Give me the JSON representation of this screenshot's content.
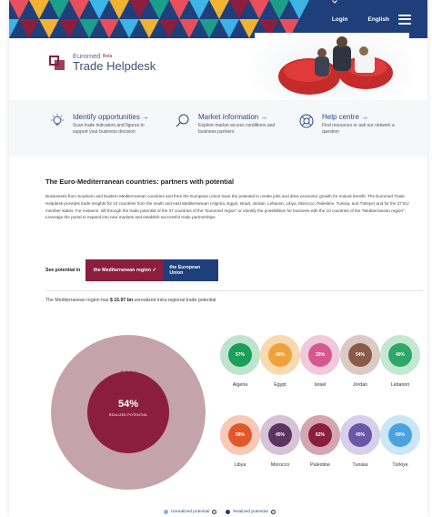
{
  "nav": {
    "login": "Login",
    "language": "English"
  },
  "brand": {
    "small": "Euromed",
    "big": "Trade Helpdesk",
    "beta": "Beta"
  },
  "features": [
    {
      "title": "Identify opportunities →",
      "desc1": "Scan trade indicators and figures to",
      "desc2": "support your business decision",
      "icon": "bulb-icon"
    },
    {
      "title": "Market information →",
      "desc1": "Explore market access conditions and",
      "desc2": "business partners",
      "icon": "search-icon"
    },
    {
      "title": "Help centre →",
      "desc1": "Find resources or ask our network a",
      "desc2": "question",
      "icon": "lifebuoy-icon"
    }
  ],
  "article": {
    "title": "The Euro-Mediterranean countries: partners with potential",
    "body": "Businesses from Southern and Eastern Mediterranean countries and from the European Union have the potential to create jobs and drive economic growth for mutual benefit. The Euromed Trade Helpdesk provides trade insights for 10 countries from the south and east Mediterranean (Algeria, Egypt, Israel, Jordan, Lebanon, Libya, Morocco, Palestine, Tunisia, and Türkiye) and for the 27 EU member states. For instance, sift through the trade potential of the 37 countries of the \"Euromed region\" or identify the possibilities for business with the 10 countries of the \"Mediterranean region\". Leverage the portal to expand into new markets and establish successful trade partnerships."
  },
  "switch": {
    "label": "See potential in",
    "option_a": "the Mediterranean region ✓",
    "option_b": "the European Union"
  },
  "summary": {
    "prefix": "The Mediterranean region has ",
    "amount": "$ 15.97 bn",
    "suffix": " unrealized intra-regional trade potential"
  },
  "chart_data": {
    "type": "pie",
    "main": {
      "unrealized_pct": "46%",
      "unrealized_label": "UNREALIZED POTENTIAL",
      "realized_pct": "54%",
      "realized_label": "REALIZED POTENTIAL"
    },
    "countries": [
      {
        "name": "Algeria",
        "realized": "57%",
        "inner": "#1b9e58",
        "outer": "#bfe3cc"
      },
      {
        "name": "Egypt",
        "realized": "49%",
        "inner": "#f0a23a",
        "outer": "#f8d9b0"
      },
      {
        "name": "Israel",
        "realized": "33%",
        "inner": "#d6588f",
        "outer": "#f0c9dc"
      },
      {
        "name": "Jordan",
        "realized": "54%",
        "inner": "#8a5a4a",
        "outer": "#dccbc4"
      },
      {
        "name": "Lebanon",
        "realized": "40%",
        "inner": "#2fa66a",
        "outer": "#c4e8d2"
      },
      {
        "name": "Libya",
        "realized": "58%",
        "inner": "#e0582c",
        "outer": "#f7c9b6"
      },
      {
        "name": "Morocco",
        "realized": "45%",
        "inner": "#5c3460",
        "outer": "#d6c3d6"
      },
      {
        "name": "Palestine",
        "realized": "62%",
        "inner": "#8b1e3f",
        "outer": "#d3a6b1"
      },
      {
        "name": "Tunisia",
        "realized": "45%",
        "inner": "#6b57a8",
        "outer": "#d7d0ea"
      },
      {
        "name": "Türkiye",
        "realized": "60%",
        "inner": "#4aa3df",
        "outer": "#cbe6f7"
      }
    ],
    "legend": [
      "Unrealized potential",
      "Realized potential"
    ]
  },
  "colors": {
    "navy": "#1f3f7a",
    "burgundy": "#8b1e3f",
    "donut_outer": "#c5a3ac"
  }
}
